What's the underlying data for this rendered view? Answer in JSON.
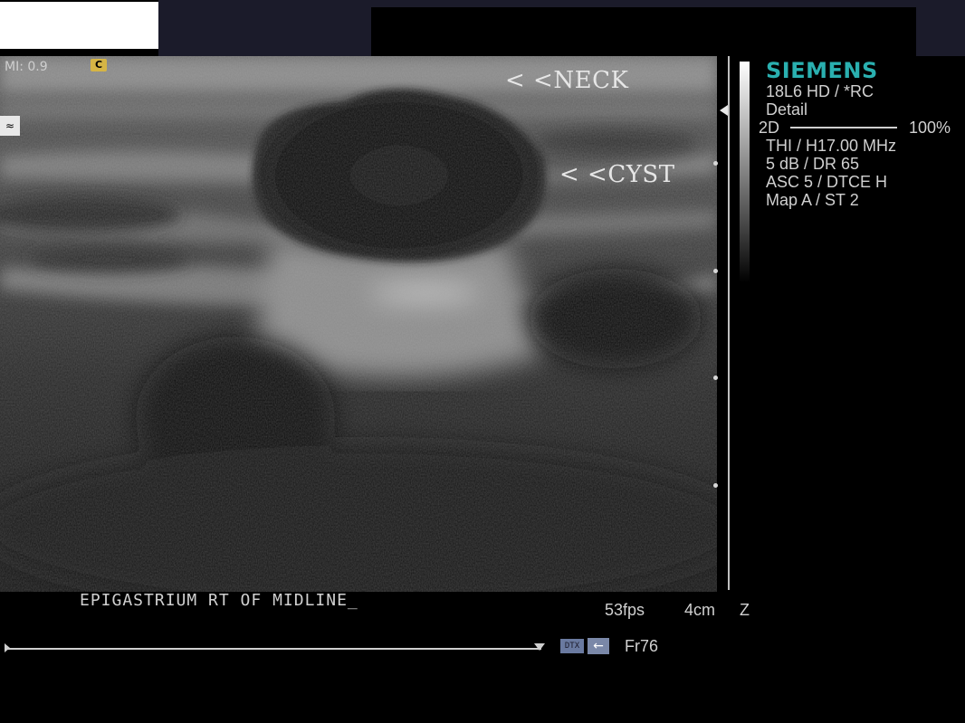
{
  "header": {
    "mi": "MI: 0.9",
    "mode_icon": "cine-icon",
    "probe_icon": "probe-orientation-icon"
  },
  "annotations": {
    "neck": "< <NECK",
    "cyst": "< <CYST"
  },
  "side_panel": {
    "brand": "SIEMENS",
    "brand_color": "#2ab0b0",
    "probe": "18L6 HD / *RC",
    "preset": "Detail",
    "mode": "2D",
    "power": "100%",
    "frequency": "THI / H17.00 MHz",
    "gain": "5 dB / DR 65",
    "asc": "ASC 5 / DTCE H",
    "map": "Map A / ST 2"
  },
  "footer": {
    "caption": "EPIGASTRIUM RT OF MIDLINE_",
    "fps": "53fps",
    "depth": "4cm",
    "zoom": "Z",
    "dtx_badge": "DTX",
    "frame": "Fr76"
  }
}
